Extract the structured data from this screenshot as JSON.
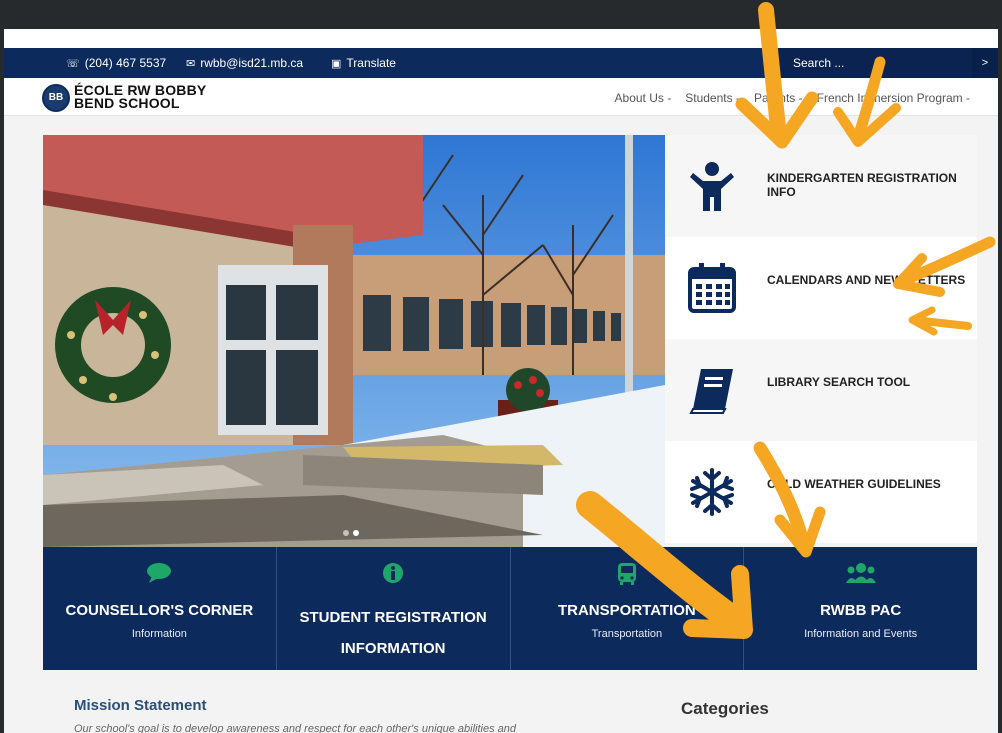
{
  "topbar": {
    "phone": "(204) 467 5537",
    "email": "rwbb@isd21.mb.ca",
    "translate": "Translate",
    "search_placeholder": "Search ...",
    "search_button": ">"
  },
  "brand": {
    "logo_text": "BB",
    "line1": "ÉCOLE RW BOBBY",
    "line2": "BEND SCHOOL"
  },
  "nav": [
    {
      "label": "About Us -"
    },
    {
      "label": "Students -"
    },
    {
      "label": "Parents -"
    },
    {
      "label": "French Immersion Program -"
    }
  ],
  "side_links": [
    {
      "label": "KINDERGARTEN REGISTRATION INFO",
      "icon": "child-icon"
    },
    {
      "label": "CALENDARS AND NEWSLETTERS",
      "icon": "calendar-icon"
    },
    {
      "label": "LIBRARY SEARCH TOOL",
      "icon": "book-icon"
    },
    {
      "label": "COLD WEATHER GUIDELINES",
      "icon": "snowflake-icon"
    }
  ],
  "tiles": [
    {
      "title": "COUNSELLOR'S CORNER",
      "sub": "Information",
      "icon": "comment-icon"
    },
    {
      "title": "STUDENT REGISTRATION INFORMATION",
      "sub": "",
      "icon": "info-icon"
    },
    {
      "title": "TRANSPORTATION",
      "sub": "Transportation",
      "icon": "bus-icon"
    },
    {
      "title": "RWBB PAC",
      "sub": "Information and Events",
      "icon": "users-icon"
    }
  ],
  "mission": {
    "heading": "Mission Statement",
    "text": "Our school's goal is to develop awareness and respect for each other's unique abilities and"
  },
  "categories": {
    "heading": "Categories"
  },
  "colors": {
    "navy": "#0d2a5c",
    "accent_arrow": "#f5a623",
    "tile_icon": "#1fa76a"
  }
}
